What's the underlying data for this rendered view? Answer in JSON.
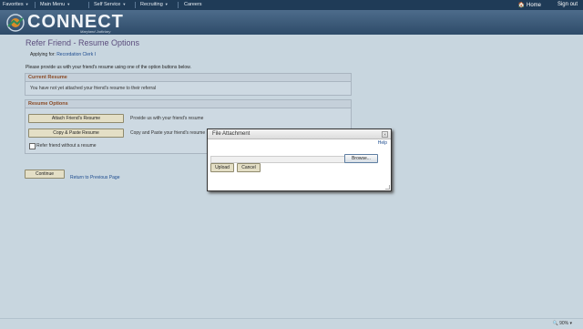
{
  "nav": {
    "items": [
      "Favorites",
      "Main Menu",
      "Self Service",
      "Recruiting",
      "Careers"
    ],
    "home_label": "Home",
    "signout_label": "Sign out"
  },
  "brand": {
    "name": "CONNECT",
    "subtitle": "Maryland Judiciary"
  },
  "page": {
    "title": "Refer Friend - Resume Options",
    "applying_label": "Applying for:",
    "applying_job": "Recordation Clerk I",
    "instructions": "Please provide us with your friend's resume using one of the option buttons below."
  },
  "current_resume": {
    "header": "Current Resume",
    "message": "You have not yet attached your friend's resume to their referral"
  },
  "resume_options": {
    "header": "Resume Options",
    "attach_button": "Attach Friend's Resume",
    "attach_desc": "Provide us with your friend's resume",
    "paste_button": "Copy & Paste Resume",
    "paste_desc": "Copy and Paste your friend's resume",
    "without_label": "Refer friend without a resume",
    "without_checked": false
  },
  "actions": {
    "continue_label": "Continue",
    "return_label": "Return to Previous Page"
  },
  "dialog": {
    "title": "File Attachment",
    "help_label": "Help",
    "browse_label": "Browse...",
    "upload_label": "Upload",
    "cancel_label": "Cancel"
  },
  "status": {
    "zoom": "90%"
  }
}
